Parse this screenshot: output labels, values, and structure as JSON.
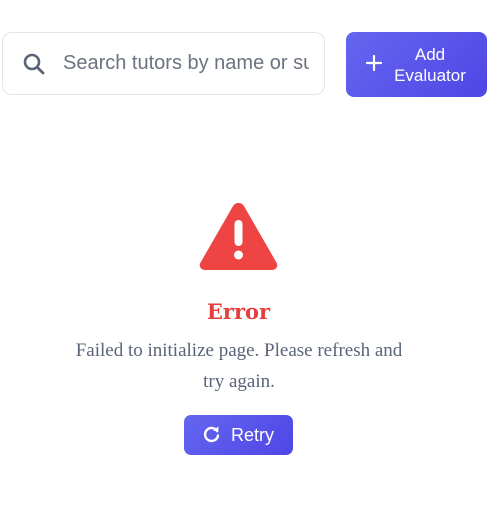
{
  "search": {
    "placeholder": "Search tutors by name or subject...",
    "icon": "search-icon"
  },
  "toolbar": {
    "add_label": "Add Evaluator",
    "add_icon": "plus-icon",
    "accent_color": "#5856eb"
  },
  "error": {
    "icon": "warning-triangle-icon",
    "icon_color": "#ef4444",
    "title": "Error",
    "title_color": "#e53e3e",
    "message": "Failed to initialize page. Please refresh and try again.",
    "retry_label": "Retry",
    "retry_icon": "refresh-icon"
  }
}
